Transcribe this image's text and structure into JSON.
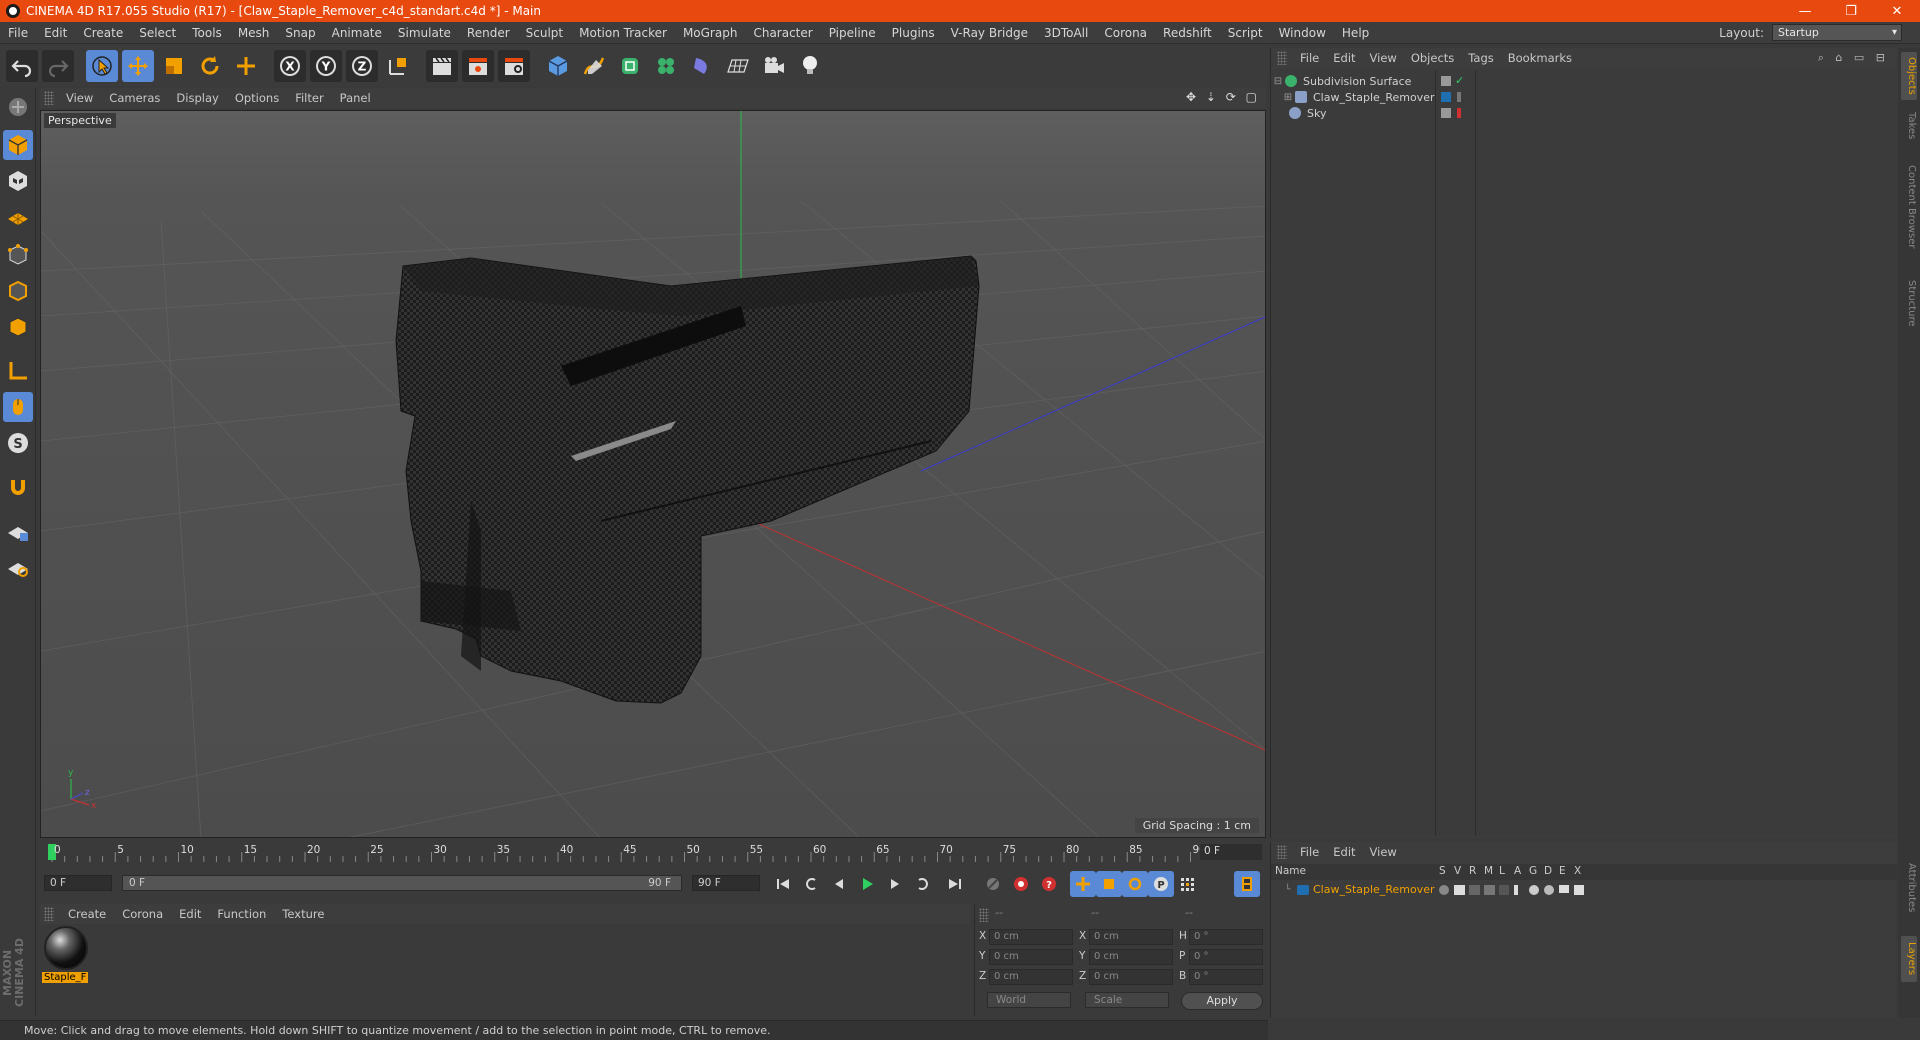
{
  "window": {
    "title": "CINEMA 4D R17.055 Studio (R17) - [Claw_Staple_Remover_c4d_standart.c4d *] - Main",
    "controls": [
      "—",
      "❐",
      "✕"
    ]
  },
  "menu": [
    "File",
    "Edit",
    "Create",
    "Select",
    "Tools",
    "Mesh",
    "Snap",
    "Animate",
    "Simulate",
    "Render",
    "Sculpt",
    "Motion Tracker",
    "MoGraph",
    "Character",
    "Pipeline",
    "Plugins",
    "V-Ray Bridge",
    "3DToAll",
    "Corona",
    "Redshift",
    "Script",
    "Window",
    "Help"
  ],
  "layout": {
    "label": "Layout:",
    "value": "Startup"
  },
  "viewport": {
    "menu": [
      "View",
      "Cameras",
      "Display",
      "Options",
      "Filter",
      "Panel"
    ],
    "nav_icons": "✥ ⇣ ⟳ ▢",
    "label": "Perspective",
    "grid_spacing": "Grid Spacing : 1 cm",
    "axis_labels": {
      "y": "y",
      "x": "x",
      "z": "z"
    }
  },
  "timeline": {
    "ticks": [
      "0",
      "5",
      "10",
      "15",
      "20",
      "25",
      "30",
      "35",
      "40",
      "45",
      "50",
      "55",
      "60",
      "65",
      "70",
      "75",
      "80",
      "85",
      "90"
    ],
    "current_frame": "0 F",
    "start_field": "0 F",
    "slider_start": "0 F",
    "slider_end": "90 F",
    "end_field": "90 F"
  },
  "material_manager": {
    "menu": [
      "Create",
      "Corona",
      "Edit",
      "Function",
      "Texture"
    ],
    "materials": [
      {
        "name": "Staple_F"
      }
    ]
  },
  "coordinates": {
    "headers": [
      "--",
      "--",
      "--"
    ],
    "rows": [
      {
        "a": "X",
        "a_val": "0 cm",
        "b": "X",
        "b_val": "0 cm",
        "c": "H",
        "c_val": "0 °"
      },
      {
        "a": "Y",
        "a_val": "0 cm",
        "b": "Y",
        "b_val": "0 cm",
        "c": "P",
        "c_val": "0 °"
      },
      {
        "a": "Z",
        "a_val": "0 cm",
        "b": "Z",
        "b_val": "0 cm",
        "c": "B",
        "c_val": "0 °"
      }
    ],
    "space": "World",
    "mode": "Scale",
    "apply": "Apply"
  },
  "object_manager": {
    "menu": [
      "File",
      "Edit",
      "View",
      "Objects",
      "Tags",
      "Bookmarks"
    ],
    "objects": [
      {
        "name": "Subdivision Surface",
        "icon_color": "#3ab26b"
      },
      {
        "name": "Claw_Staple_Remover",
        "icon_color": "#8aa0c8"
      },
      {
        "name": "Sky",
        "icon_color": "#8aa0c8"
      }
    ]
  },
  "layer_manager": {
    "menu": [
      "File",
      "Edit",
      "View"
    ],
    "columns": [
      "Name",
      "S",
      "V",
      "R",
      "M",
      "L",
      "A",
      "G",
      "D",
      "E",
      "X"
    ],
    "layers": [
      {
        "name": "Claw_Staple_Remover",
        "color": "#1f6fb0"
      }
    ]
  },
  "side_tabs": [
    "Objects",
    "Takes",
    "Content Browser",
    "Structure",
    "Attributes",
    "Layers"
  ],
  "brand": {
    "line1": "MAXON",
    "line2": "CINEMA 4D"
  },
  "status": "Move: Click and drag to move elements. Hold down SHIFT to quantize movement / add to the selection in point mode, CTRL to remove.",
  "colors": {
    "titlebar": "#e8490f",
    "accent": "#f0a000",
    "selected_blue": "#5a8ad6"
  }
}
